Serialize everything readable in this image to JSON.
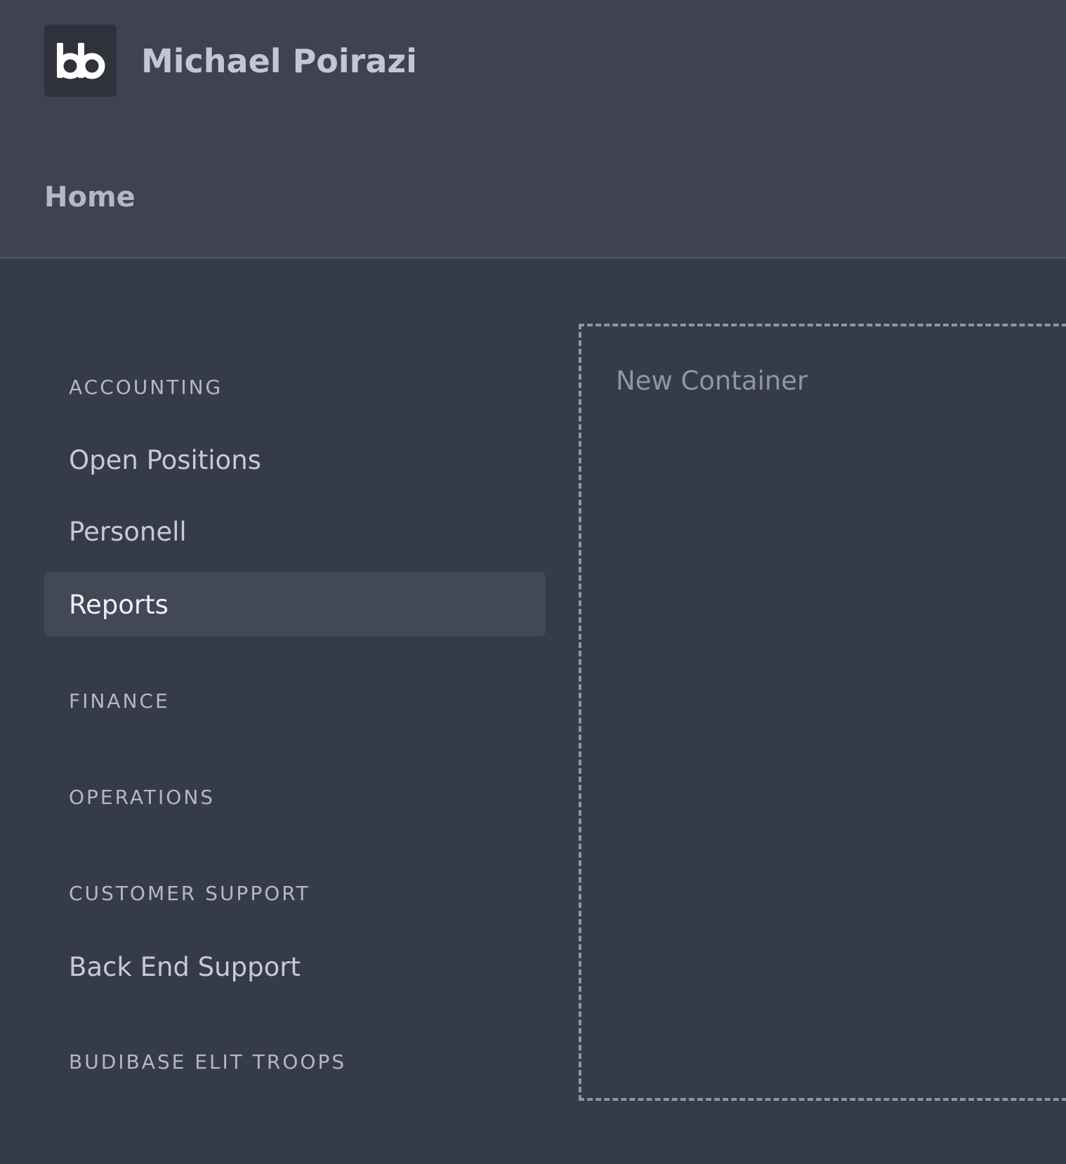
{
  "header": {
    "logo_icon": "budibase-logo-icon",
    "title": "Michael Poirazi",
    "home_link": "Home"
  },
  "sidebar": {
    "sections": [
      {
        "label": "ACCOUNTING",
        "links": [
          {
            "label": "Open Positions",
            "active": false
          },
          {
            "label": "Personell",
            "active": false
          },
          {
            "label": "Reports",
            "active": true
          }
        ]
      },
      {
        "label": "FINANCE",
        "links": []
      },
      {
        "label": "OPERATIONS",
        "links": []
      },
      {
        "label": "CUSTOMER SUPPORT",
        "links": [
          {
            "label": "Back End Support",
            "active": false
          }
        ]
      },
      {
        "label": "BUDIBASE ELIT TROOPS",
        "links": []
      }
    ]
  },
  "main": {
    "container_label": "New Container"
  },
  "colors": {
    "page_background": "#363b48",
    "header_background": "#3e4251",
    "active_link_background": "#434856",
    "dashed_border": "#8f95a3"
  }
}
